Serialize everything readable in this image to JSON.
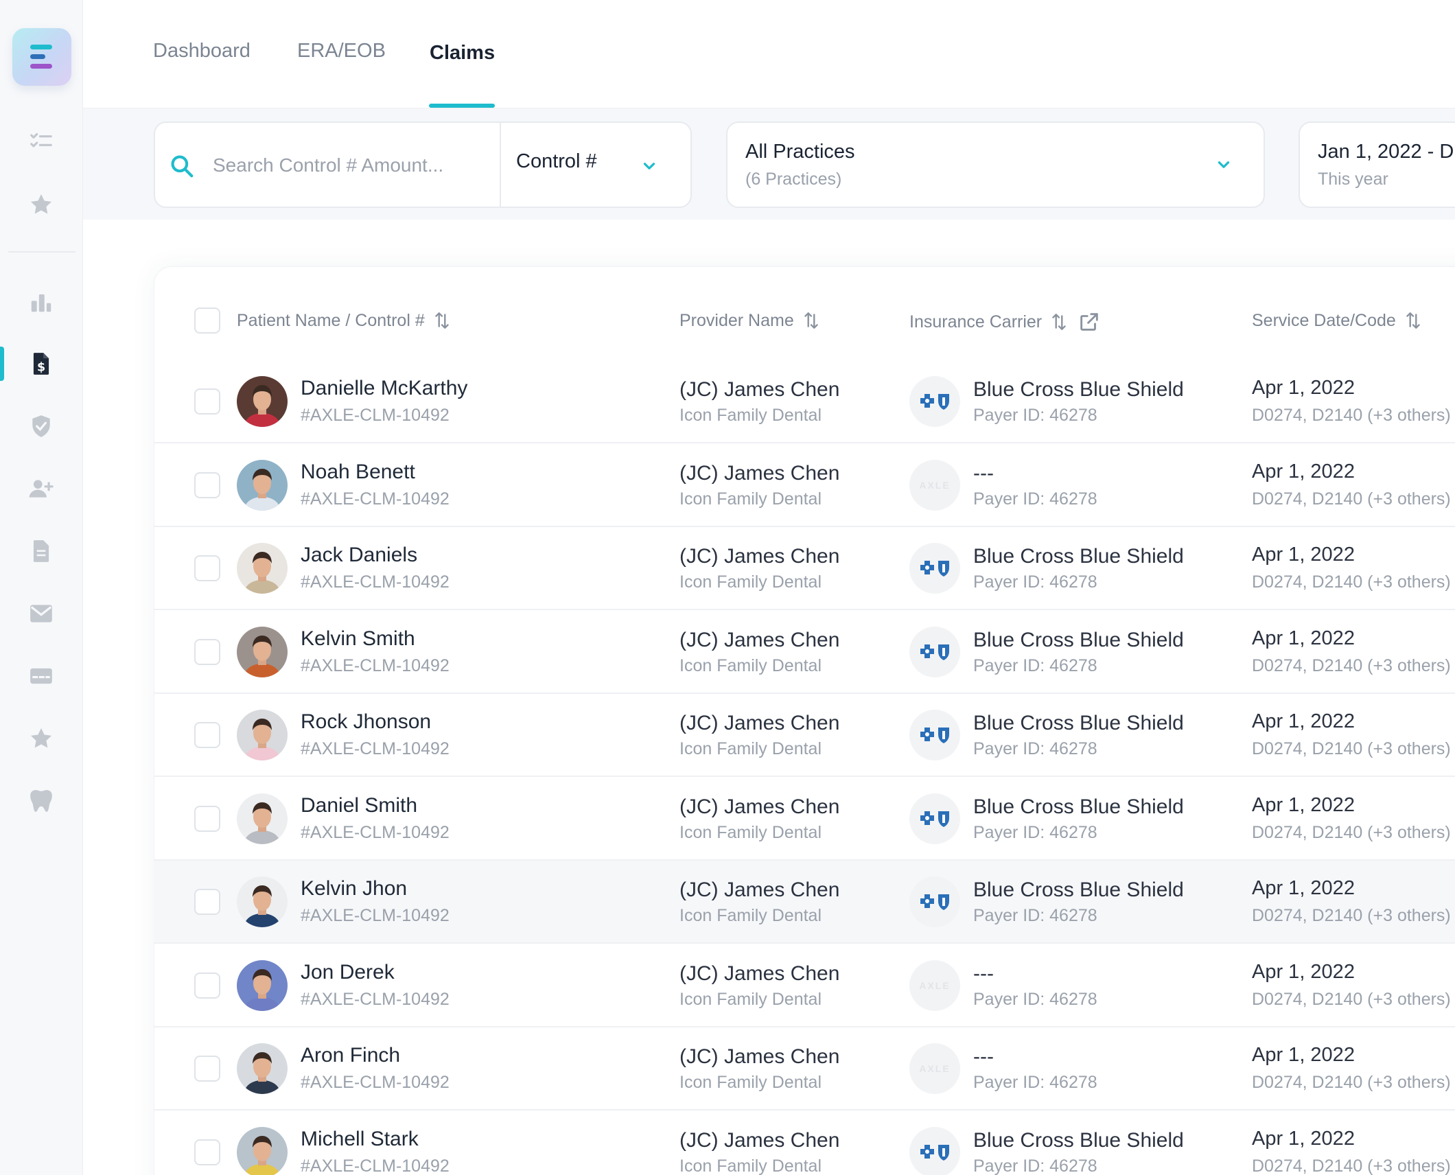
{
  "nav": {
    "tabs": [
      {
        "label": "Dashboard"
      },
      {
        "label": "ERA/EOB"
      },
      {
        "label": "Claims",
        "active": true
      }
    ]
  },
  "sidebar": {
    "icons": [
      "checklist-icon",
      "star-icon",
      "bar-chart-icon",
      "invoice-dollar-icon",
      "shield-check-icon",
      "add-user-icon",
      "document-icon",
      "mail-icon",
      "card-icon",
      "star-icon",
      "tooth-icon"
    ],
    "active": "invoice-dollar-icon"
  },
  "filters": {
    "search_placeholder": "Search Control # Amount...",
    "search_field": "Control #",
    "practices_title": "All Practices",
    "practices_sub": "(6 Practices)",
    "date_range": "Jan 1, 2022 - D",
    "date_sub": "This year"
  },
  "table": {
    "columns": {
      "patient": "Patient Name / Control #",
      "provider": "Provider Name",
      "carrier": "Insurance Carrier",
      "service": "Service Date/Code"
    },
    "rows": [
      {
        "name": "Danielle McKarthy",
        "control": "#AXLE-CLM-10492",
        "provider": "(JC) James Chen",
        "practice": "Icon Family Dental",
        "carrier": "Blue Cross Blue Shield",
        "payer": "Payer ID: 46278",
        "date": "Apr 1, 2022",
        "codes": "D0274, D2140 (+3 others)",
        "has_logo": true
      },
      {
        "name": "Noah Benett",
        "control": "#AXLE-CLM-10492",
        "provider": "(JC) James Chen",
        "practice": "Icon Family Dental",
        "carrier": "---",
        "payer": "Payer ID: 46278",
        "date": "Apr 1, 2022",
        "codes": "D0274, D2140 (+3 others)",
        "has_logo": false
      },
      {
        "name": "Jack Daniels",
        "control": "#AXLE-CLM-10492",
        "provider": "(JC) James Chen",
        "practice": "Icon Family Dental",
        "carrier": "Blue Cross Blue Shield",
        "payer": "Payer ID: 46278",
        "date": "Apr 1, 2022",
        "codes": "D0274, D2140 (+3 others)",
        "has_logo": true
      },
      {
        "name": "Kelvin Smith",
        "control": "#AXLE-CLM-10492",
        "provider": "(JC) James Chen",
        "practice": "Icon Family Dental",
        "carrier": "Blue Cross Blue Shield",
        "payer": "Payer ID: 46278",
        "date": "Apr 1, 2022",
        "codes": "D0274, D2140 (+3 others)",
        "has_logo": true
      },
      {
        "name": "Rock Jhonson",
        "control": "#AXLE-CLM-10492",
        "provider": "(JC) James Chen",
        "practice": "Icon Family Dental",
        "carrier": "Blue Cross Blue Shield",
        "payer": "Payer ID: 46278",
        "date": "Apr 1, 2022",
        "codes": "D0274, D2140 (+3 others)",
        "has_logo": true
      },
      {
        "name": "Daniel Smith",
        "control": "#AXLE-CLM-10492",
        "provider": "(JC) James Chen",
        "practice": "Icon Family Dental",
        "carrier": "Blue Cross Blue Shield",
        "payer": "Payer ID: 46278",
        "date": "Apr 1, 2022",
        "codes": "D0274, D2140 (+3 others)",
        "has_logo": true
      },
      {
        "name": "Kelvin Jhon",
        "control": "#AXLE-CLM-10492",
        "provider": "(JC) James Chen",
        "practice": "Icon Family Dental",
        "carrier": "Blue Cross Blue Shield",
        "payer": "Payer ID: 46278",
        "date": "Apr 1, 2022",
        "codes": "D0274, D2140 (+3 others)",
        "has_logo": true,
        "highlighted": true
      },
      {
        "name": "Jon Derek",
        "control": "#AXLE-CLM-10492",
        "provider": "(JC) James Chen",
        "practice": "Icon Family Dental",
        "carrier": "---",
        "payer": "Payer ID: 46278",
        "date": "Apr 1, 2022",
        "codes": "D0274, D2140 (+3 others)",
        "has_logo": false
      },
      {
        "name": "Aron Finch",
        "control": "#AXLE-CLM-10492",
        "provider": "(JC) James Chen",
        "practice": "Icon Family Dental",
        "carrier": "---",
        "payer": "Payer ID: 46278",
        "date": "Apr 1, 2022",
        "codes": "D0274, D2140 (+3 others)",
        "has_logo": false
      },
      {
        "name": "Michell Stark",
        "control": "#AXLE-CLM-10492",
        "provider": "(JC) James Chen",
        "practice": "Icon Family Dental",
        "carrier": "Blue Cross Blue Shield",
        "payer": "Payer ID: 46278",
        "date": "Apr 1, 2022",
        "codes": "D0274, D2140 (+3 others)",
        "has_logo": true
      }
    ]
  },
  "colors": {
    "accent": "#1ebccc",
    "bcbs_blue": "#2a6fb8",
    "avatar_shirts": [
      "#c23040",
      "#dfe6ee",
      "#c9b79a",
      "#c8602d",
      "#f0c7d2",
      "#b9bcc2",
      "#23426e",
      "#6f7ec4",
      "#2d3a4e",
      "#e4c64a"
    ],
    "avatar_bg": [
      "#5a3b33",
      "#8fb2c6",
      "#e9e6e2",
      "#9b928e",
      "#d8dadd",
      "#eceef0",
      "#eceef0",
      "#7186c8",
      "#d7dbe0",
      "#b8c3cc"
    ]
  }
}
